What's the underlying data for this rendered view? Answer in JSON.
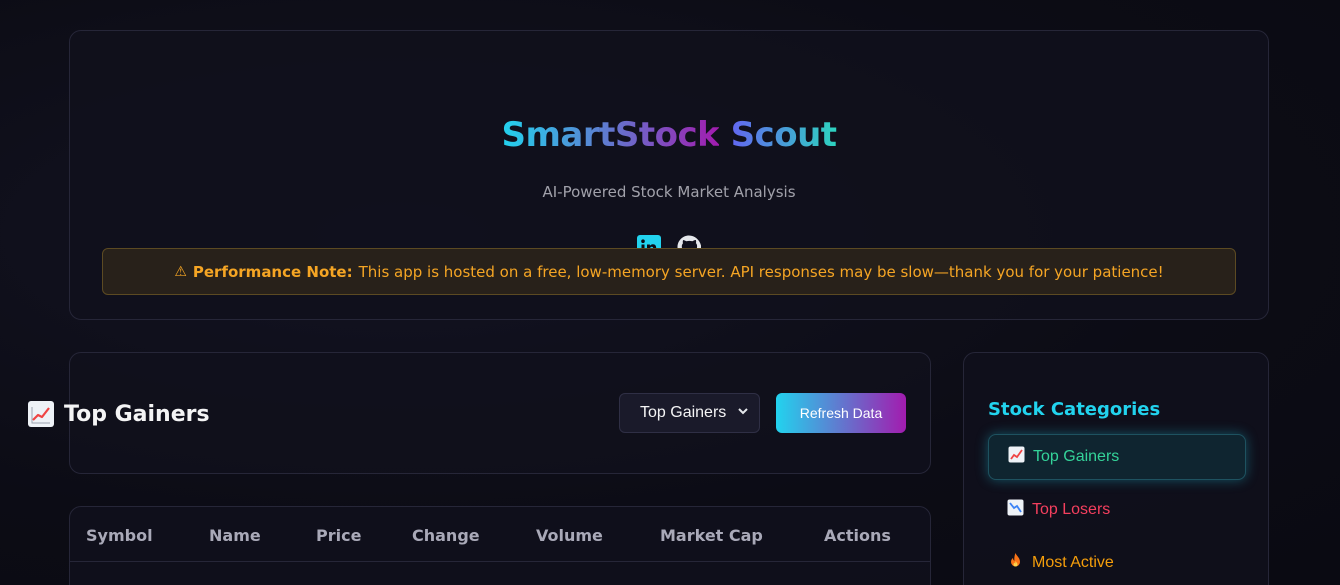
{
  "header": {
    "title_word1": "SmartStock",
    "title_word2": "Scout",
    "subtitle": "AI-Powered Stock Market Analysis",
    "socials": [
      {
        "icon": "linkedin-icon",
        "label": "in"
      },
      {
        "icon": "github-icon"
      }
    ],
    "notice": {
      "icon": "warning-icon",
      "label": "Performance Note:",
      "text": "This app is hosted on a free, low-memory server. API responses may be slow—thank you for your patience!"
    }
  },
  "controls": {
    "section_title": "Top Gainers",
    "section_icon": "chart-increasing-icon",
    "select_value": "Top Gainers",
    "refresh_label": "Refresh Data"
  },
  "table": {
    "columns": [
      "Symbol",
      "Name",
      "Price",
      "Change",
      "Volume",
      "Market Cap",
      "Actions"
    ]
  },
  "sidebar": {
    "title": "Stock Categories",
    "items": [
      {
        "label": "Top Gainers",
        "icon": "chart-increasing-icon",
        "color": "#34d399",
        "active": true
      },
      {
        "label": "Top Losers",
        "icon": "chart-decreasing-icon",
        "color": "#f43f5e",
        "active": false
      },
      {
        "label": "Most Active",
        "icon": "fire-icon",
        "color": "#f59e0b",
        "active": false
      }
    ]
  },
  "colors": {
    "accent_cyan": "#22d3ee",
    "accent_purple": "#a21caf",
    "warning": "#f5a524"
  }
}
